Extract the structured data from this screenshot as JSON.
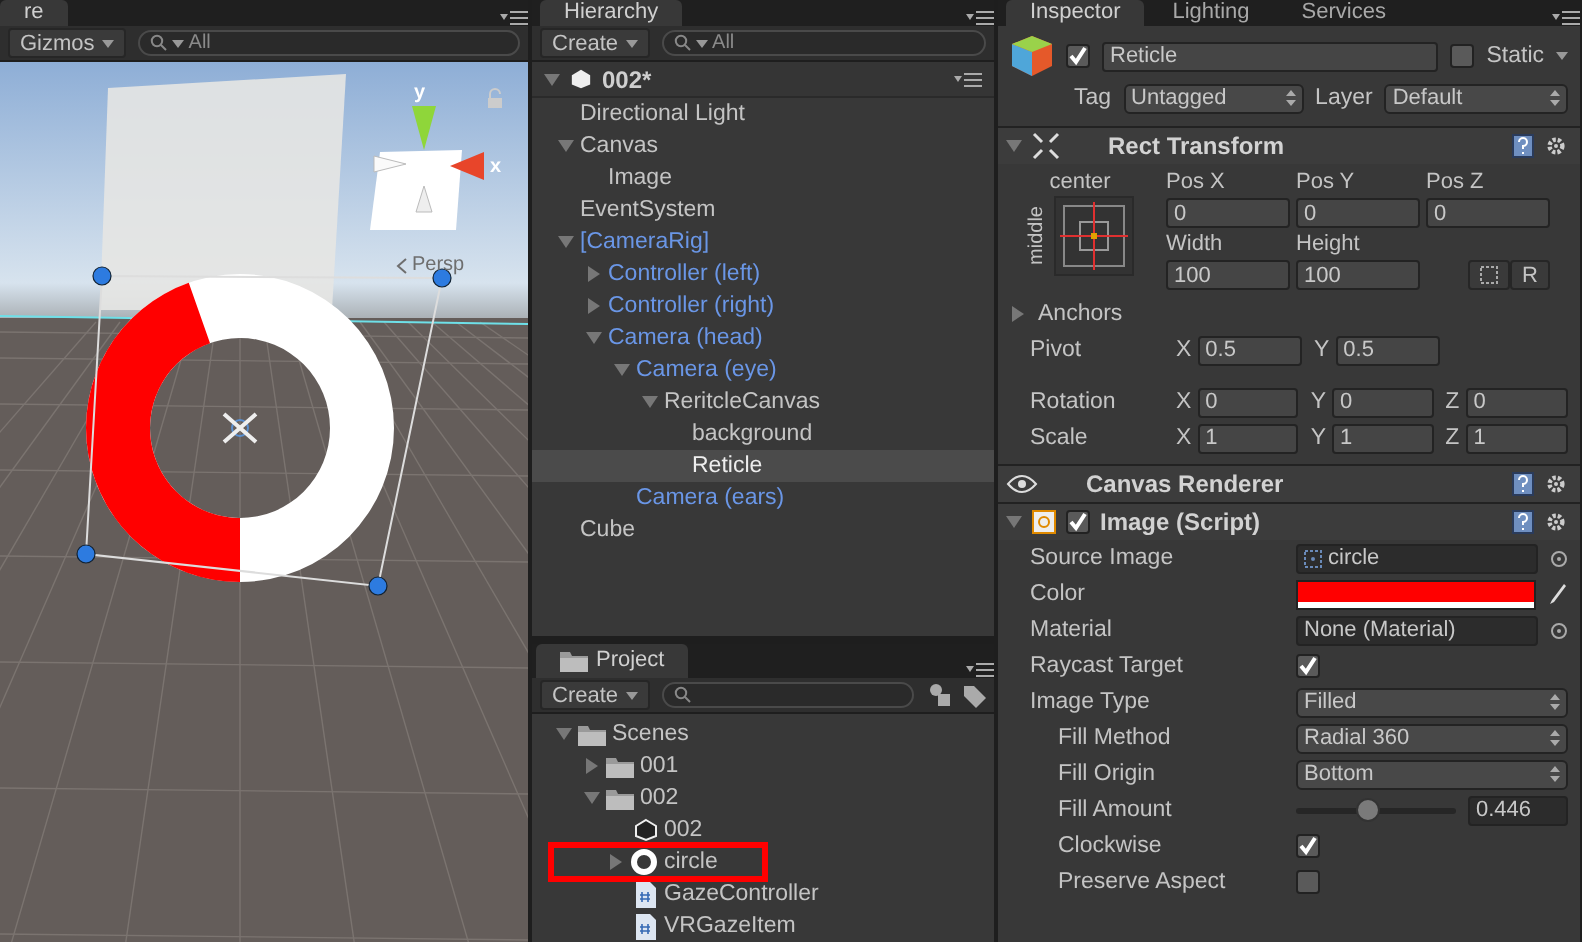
{
  "scene": {
    "tab": "re",
    "gizmos": "Gizmos",
    "search": "All",
    "axis_y": "y",
    "axis_x": "x",
    "projection": "Persp"
  },
  "hierarchy": {
    "tab": "Hierarchy",
    "create": "Create",
    "search": "All",
    "scene": "002*",
    "items": [
      {
        "label": "Directional Light",
        "prefab": false,
        "selected": false
      },
      {
        "label": "Canvas",
        "prefab": false,
        "selected": false,
        "expanded": true,
        "children": [
          {
            "label": "Image",
            "prefab": false,
            "selected": false
          }
        ]
      },
      {
        "label": "EventSystem",
        "prefab": false,
        "selected": false
      },
      {
        "label": "[CameraRig]",
        "prefab": true,
        "selected": false,
        "expanded": true,
        "children": [
          {
            "label": "Controller (left)",
            "prefab": true,
            "selected": false,
            "expanded": false
          },
          {
            "label": "Controller (right)",
            "prefab": true,
            "selected": false,
            "expanded": false
          },
          {
            "label": "Camera (head)",
            "prefab": true,
            "selected": false,
            "expanded": true,
            "children": [
              {
                "label": "Camera (eye)",
                "prefab": true,
                "selected": false,
                "expanded": true,
                "children": [
                  {
                    "label": "ReritcleCanvas",
                    "prefab": false,
                    "selected": false,
                    "expanded": true,
                    "children": [
                      {
                        "label": "background",
                        "prefab": false,
                        "selected": false
                      },
                      {
                        "label": "Reticle",
                        "prefab": false,
                        "selected": true
                      }
                    ]
                  }
                ]
              },
              {
                "label": "Camera (ears)",
                "prefab": true,
                "selected": false
              }
            ]
          }
        ]
      },
      {
        "label": "Cube",
        "prefab": false,
        "selected": false
      }
    ]
  },
  "project": {
    "tab": "Project",
    "create": "Create",
    "items": [
      {
        "label": "Scenes",
        "kind": "folder",
        "expanded": true,
        "highlighted": false,
        "children": [
          {
            "label": "001",
            "kind": "folder",
            "expanded": false,
            "highlighted": false
          },
          {
            "label": "002",
            "kind": "folder",
            "expanded": true,
            "highlighted": false,
            "children": [
              {
                "label": "002",
                "kind": "scene",
                "highlighted": false
              },
              {
                "label": "circle",
                "kind": "sprite",
                "expanded": false,
                "highlighted": true
              },
              {
                "label": "GazeController",
                "kind": "script",
                "highlighted": false
              },
              {
                "label": "VRGazeItem",
                "kind": "script",
                "highlighted": false
              }
            ]
          }
        ]
      }
    ]
  },
  "inspector": {
    "tabs": [
      {
        "label": "Inspector",
        "selected": true
      },
      {
        "label": "Lighting",
        "selected": false
      },
      {
        "label": "Services",
        "selected": false
      }
    ],
    "object": {
      "active": true,
      "name": "Reticle",
      "static_label": "Static",
      "static": false,
      "tag_label": "Tag",
      "tag": "Untagged",
      "layer_label": "Layer",
      "layer": "Default"
    },
    "rect_transform": {
      "title": "Rect Transform",
      "expanded": true,
      "anchor_h": "center",
      "anchor_v": "middle",
      "pos": [
        {
          "label": "Pos X",
          "value": "0"
        },
        {
          "label": "Pos Y",
          "value": "0"
        },
        {
          "label": "Pos Z",
          "value": "0"
        }
      ],
      "size": [
        {
          "label": "Width",
          "value": "100"
        },
        {
          "label": "Height",
          "value": "100"
        }
      ],
      "reset": "R",
      "anchors": {
        "label": "Anchors",
        "expanded": false
      },
      "vectors": [
        {
          "label": "Pivot",
          "values": [
            {
              "axis": "X",
              "value": "0.5"
            },
            {
              "axis": "Y",
              "value": "0.5"
            }
          ]
        },
        {
          "label": "Rotation",
          "values": [
            {
              "axis": "X",
              "value": "0"
            },
            {
              "axis": "Y",
              "value": "0"
            },
            {
              "axis": "Z",
              "value": "0"
            }
          ]
        },
        {
          "label": "Scale",
          "values": [
            {
              "axis": "X",
              "value": "1"
            },
            {
              "axis": "Y",
              "value": "1"
            },
            {
              "axis": "Z",
              "value": "1"
            }
          ]
        }
      ]
    },
    "canvas_renderer": {
      "title": "Canvas Renderer"
    },
    "image": {
      "title": "Image (Script)",
      "enabled": true,
      "expanded": true,
      "fields": [
        {
          "kind": "sprite",
          "label": "Source Image",
          "value": "circle"
        },
        {
          "kind": "color",
          "label": "Color",
          "color": "#ff0000"
        },
        {
          "kind": "object",
          "label": "Material",
          "value": "None (Material)"
        },
        {
          "kind": "checkbox",
          "label": "Raycast Target",
          "checked": true
        },
        {
          "kind": "dropdown",
          "label": "Image Type",
          "value": "Filled",
          "children": [
            {
              "kind": "dropdown",
              "label": "Fill Method",
              "value": "Radial 360"
            },
            {
              "kind": "dropdown",
              "label": "Fill Origin",
              "value": "Bottom"
            },
            {
              "kind": "slider",
              "label": "Fill Amount",
              "level": 0.446,
              "reading": "0.446"
            },
            {
              "kind": "checkbox",
              "label": "Clockwise",
              "checked": true
            },
            {
              "kind": "checkbox",
              "label": "Preserve Aspect",
              "checked": false
            }
          ]
        }
      ]
    }
  }
}
